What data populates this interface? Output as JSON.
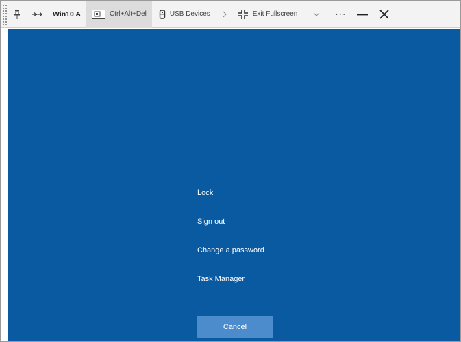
{
  "toolbar": {
    "pin_icon": "pin-icon",
    "arrows_icon": "arrows-icon",
    "vm_name": "Win10 A",
    "ctrl_alt_del": {
      "icon": "keyboard-icon",
      "label": "Ctrl+Alt+Del"
    },
    "usb": {
      "icon": "usb-icon",
      "label": "USB Devices"
    },
    "separator_icon": "chevron-right-icon",
    "exit_fullscreen": {
      "icon": "exit-fullscreen-icon",
      "label": "Exit Fullscreen"
    },
    "expand_icon": "chevron-down-icon",
    "more_label": "···",
    "minimize_icon": "minimize-icon",
    "close_icon": "close-icon"
  },
  "security_screen": {
    "background": "#0a5aa2",
    "options": [
      {
        "label": "Lock"
      },
      {
        "label": "Sign out"
      },
      {
        "label": "Change a password"
      },
      {
        "label": "Task Manager"
      }
    ],
    "cancel_label": "Cancel"
  }
}
